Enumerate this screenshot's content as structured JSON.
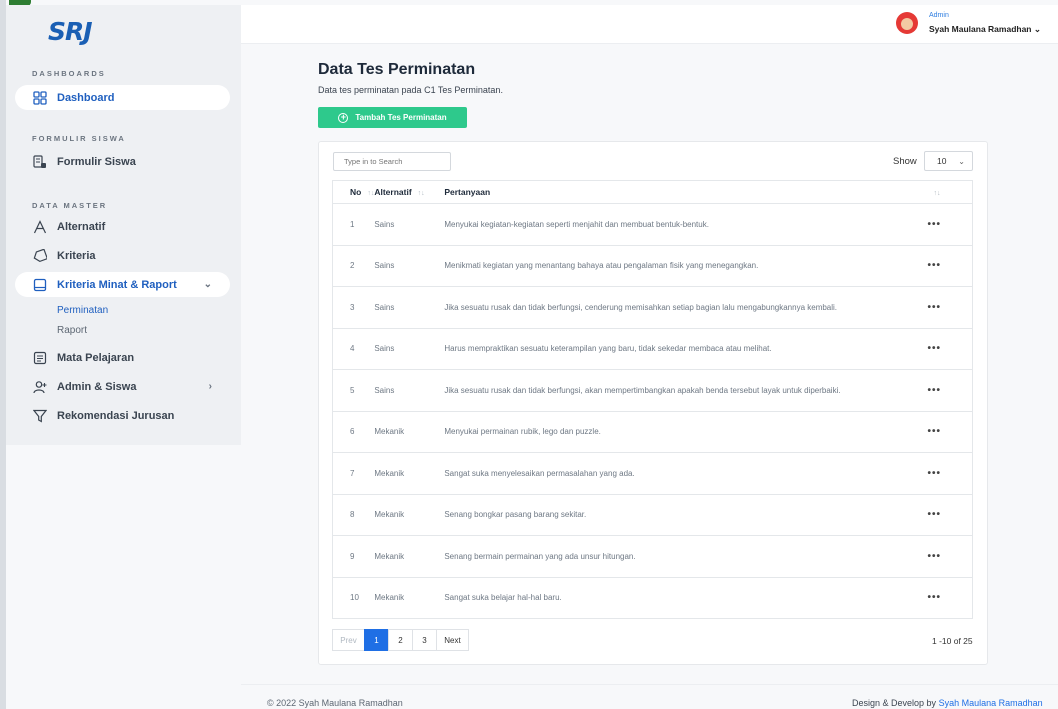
{
  "brand": {
    "logo": "SRJ"
  },
  "sidebar": {
    "sections": [
      {
        "title": "DASHBOARDS"
      },
      {
        "title": "FORMULIR SISWA"
      },
      {
        "title": "DATA MASTER"
      }
    ],
    "items": [
      {
        "label": "Dashboard",
        "icon": "grid-icon"
      },
      {
        "label": "Formulir Siswa",
        "icon": "form-icon"
      },
      {
        "label": "Alternatif",
        "icon": "letter-a-icon"
      },
      {
        "label": "Kriteria",
        "icon": "tag-icon"
      },
      {
        "label": "Kriteria Minat & Raport",
        "icon": "book-icon"
      },
      {
        "label": "Mata Pelajaran",
        "icon": "list-icon"
      },
      {
        "label": "Admin & Siswa",
        "icon": "user-add-icon"
      },
      {
        "label": "Rekomendasi Jurusan",
        "icon": "filter-icon"
      }
    ],
    "sub_items": [
      {
        "label": "Perminatan"
      },
      {
        "label": "Raport"
      }
    ]
  },
  "topbar": {
    "role": "Admin",
    "user_name": "Syah Maulana Ramadhan"
  },
  "page": {
    "title": "Data Tes Perminatan",
    "subtitle": "Data tes perminatan pada C1 Tes Perminatan.",
    "add_button": "Tambah Tes Perminatan"
  },
  "table": {
    "search_placeholder": "Type in to Search",
    "show_label": "Show",
    "show_value": "10",
    "headers": {
      "no": "No",
      "alternatif": "Alternatif",
      "pertanyaan": "Pertanyaan"
    },
    "rows": [
      {
        "no": "1",
        "alt": "Sains",
        "q": "Menyukai kegiatan-kegiatan seperti menjahit dan membuat bentuk-bentuk."
      },
      {
        "no": "2",
        "alt": "Sains",
        "q": "Menikmati kegiatan yang menantang bahaya atau pengalaman fisik yang menegangkan."
      },
      {
        "no": "3",
        "alt": "Sains",
        "q": "Jika sesuatu rusak dan tidak berfungsi, cenderung memisahkan setiap bagian lalu mengabungkannya kembali."
      },
      {
        "no": "4",
        "alt": "Sains",
        "q": "Harus mempraktikan sesuatu keterampilan yang baru, tidak sekedar membaca atau melihat."
      },
      {
        "no": "5",
        "alt": "Sains",
        "q": "Jika sesuatu rusak dan tidak berfungsi, akan mempertimbangkan apakah benda tersebut layak untuk diperbaiki."
      },
      {
        "no": "6",
        "alt": "Mekanik",
        "q": "Menyukai permainan rubik, lego dan puzzle."
      },
      {
        "no": "7",
        "alt": "Mekanik",
        "q": "Sangat suka menyelesaikan permasalahan yang ada."
      },
      {
        "no": "8",
        "alt": "Mekanik",
        "q": "Senang bongkar pasang barang sekitar."
      },
      {
        "no": "9",
        "alt": "Mekanik",
        "q": "Senang bermain permainan yang ada unsur hitungan."
      },
      {
        "no": "10",
        "alt": "Mekanik",
        "q": "Sangat suka belajar hal-hal baru."
      }
    ],
    "row_action": "•••",
    "pager": {
      "prev": "Prev",
      "pages": [
        "1",
        "2",
        "3"
      ],
      "next": "Next",
      "current": "1"
    },
    "range": "1 -10 of 25"
  },
  "footer": {
    "left": "© 2022 Syah Maulana Ramadhan",
    "right_prefix": "Design & Develop by",
    "right_link": "Syah Maulana Ramadhan"
  }
}
